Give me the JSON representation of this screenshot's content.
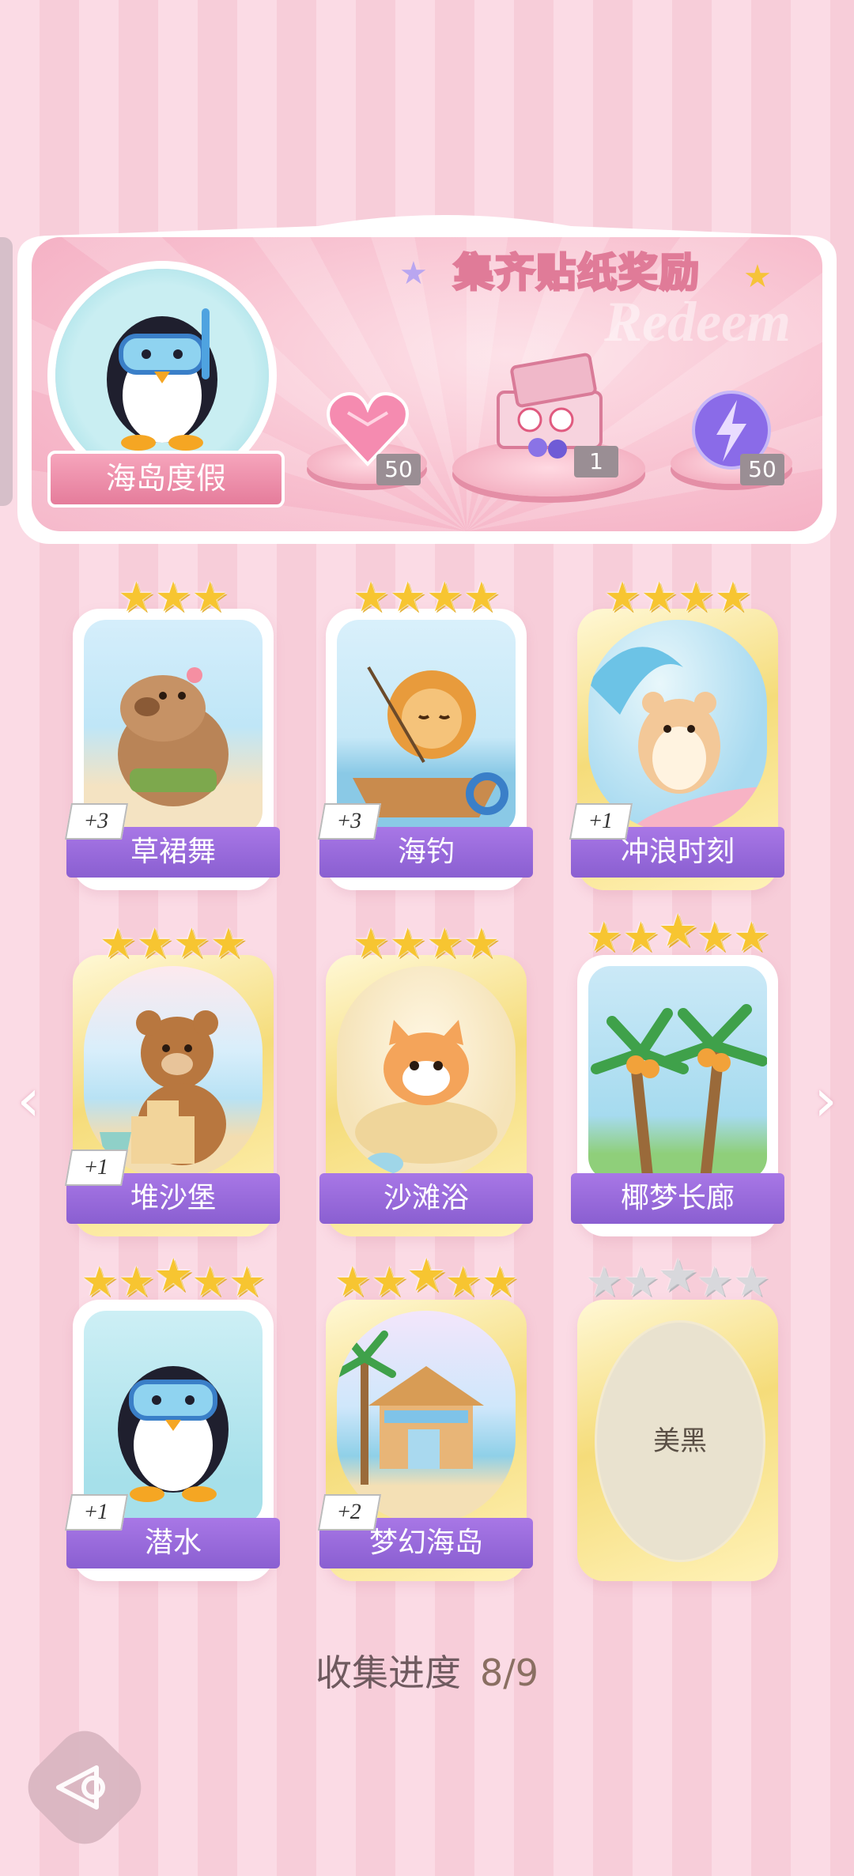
{
  "banner": {
    "title": "集齐贴纸奖励",
    "watermark": "Redeem",
    "theme_name": "海岛度假",
    "rewards": [
      {
        "icon": "pink-heart-gem-icon",
        "count": "50"
      },
      {
        "icon": "gift-box-icon",
        "count": "1"
      },
      {
        "icon": "purple-energy-orb-icon",
        "count": "50"
      }
    ]
  },
  "cards": [
    {
      "name": "草裙舞",
      "stars": 3,
      "bonus": "+3",
      "frame": "white",
      "art": "capybara-hula"
    },
    {
      "name": "海钓",
      "stars": 4,
      "bonus": "+3",
      "frame": "white",
      "art": "lion-fishing"
    },
    {
      "name": "冲浪时刻",
      "stars": 4,
      "bonus": "+1",
      "frame": "gold",
      "art": "hamster-surfing"
    },
    {
      "name": "堆沙堡",
      "stars": 4,
      "bonus": "+1",
      "frame": "gold",
      "art": "bear-sandcastle"
    },
    {
      "name": "沙滩浴",
      "stars": 4,
      "bonus": "",
      "frame": "gold",
      "art": "cat-sand-bath"
    },
    {
      "name": "椰梦长廊",
      "stars": 5,
      "bonus": "",
      "frame": "white",
      "art": "coconut-palms"
    },
    {
      "name": "潜水",
      "stars": 5,
      "bonus": "+1",
      "frame": "white",
      "art": "penguin-diving"
    },
    {
      "name": "梦幻海岛",
      "stars": 5,
      "bonus": "+2",
      "frame": "gold",
      "art": "island-hut"
    },
    {
      "name": "美黑",
      "stars": 5,
      "bonus": "",
      "frame": "gold",
      "art": "locked",
      "locked": true
    }
  ],
  "progress": {
    "label": "收集进度",
    "value": "8/9"
  },
  "colors": {
    "name_band": "#9467d8",
    "star_gold": "#f7c531",
    "star_locked": "#d8d8dc",
    "background": "#fbdbe5"
  }
}
